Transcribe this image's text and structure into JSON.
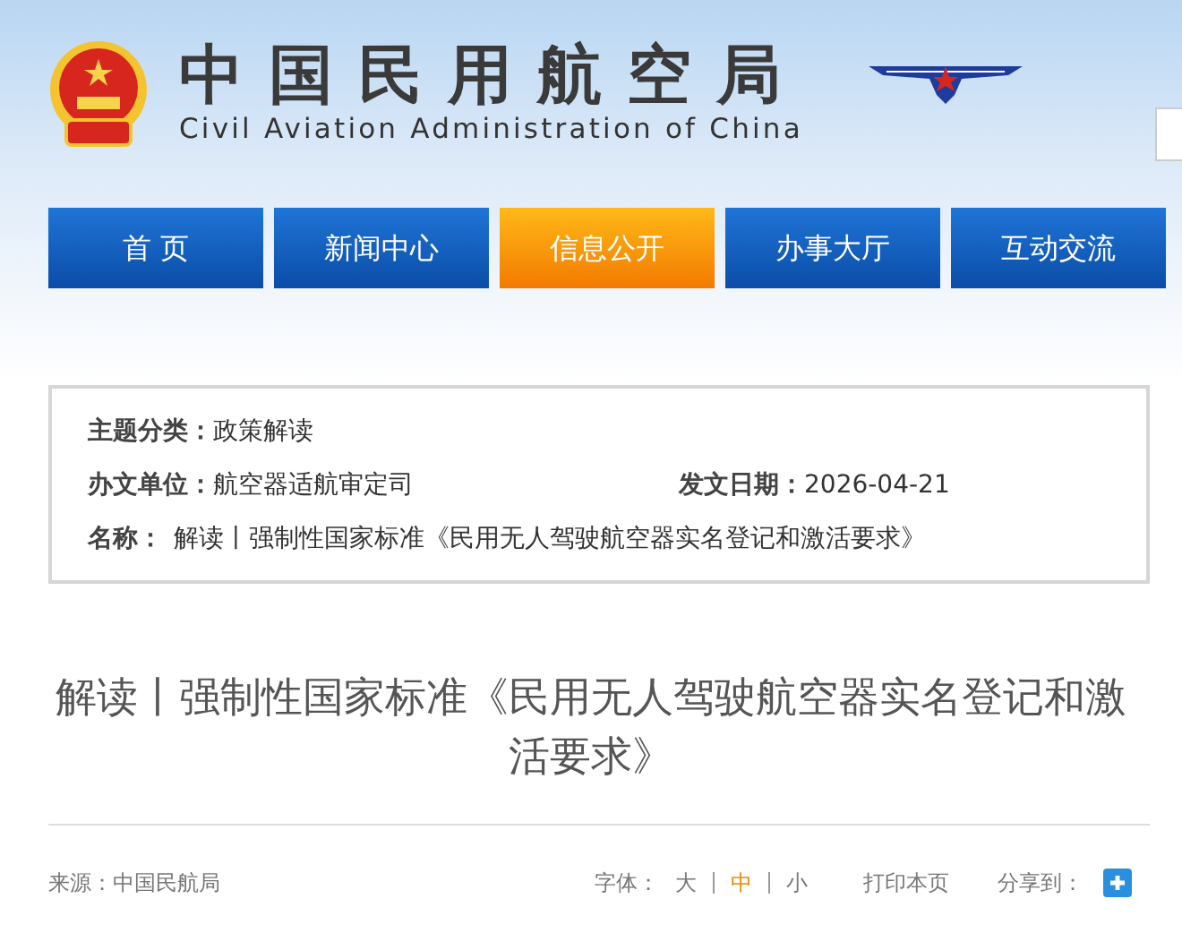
{
  "header": {
    "title": "中国民用航空局",
    "subtitle": "Civil Aviation Administration of China"
  },
  "nav": [
    {
      "label": "首 页",
      "selected": false
    },
    {
      "label": "新闻中心",
      "selected": false
    },
    {
      "label": "信息公开",
      "selected": true
    },
    {
      "label": "办事大厅",
      "selected": false
    },
    {
      "label": "互动交流",
      "selected": false
    }
  ],
  "info": {
    "rows": [
      [
        {
          "label": "主题分类：",
          "value": "政策解读"
        }
      ],
      [
        {
          "label": "办文单位：",
          "value": "航空器适航审定司"
        },
        {
          "label": "发文日期：",
          "value": "2026-04-21"
        }
      ],
      [
        {
          "label": "名称：",
          "value": "解读丨强制性国家标准《民用无人驾驶航空器实名登记和激活要求》"
        }
      ]
    ]
  },
  "article": {
    "title": "解读丨强制性国家标准《民用无人驾驶航空器实名登记和激活要求》"
  },
  "footer": {
    "source": "来源：中国民航局",
    "font_label": "字体：",
    "font_sizes": [
      {
        "label": "大",
        "selected": false
      },
      {
        "label": "中",
        "selected": true
      },
      {
        "label": "小",
        "selected": false
      }
    ],
    "print": "打印本页",
    "share_label": "分享到："
  }
}
